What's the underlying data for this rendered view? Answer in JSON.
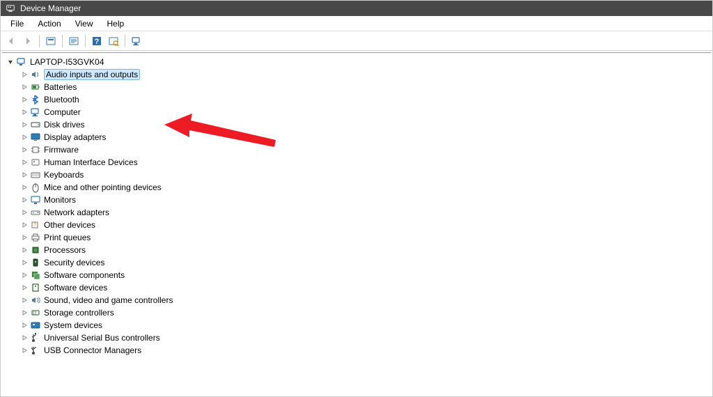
{
  "window": {
    "title": "Device Manager"
  },
  "menu": {
    "file": "File",
    "action": "Action",
    "view": "View",
    "help": "Help"
  },
  "tree": {
    "root": "LAPTOP-I53GVK04",
    "items": [
      {
        "label": "Audio inputs and outputs",
        "icon": "speaker",
        "selected": true
      },
      {
        "label": "Batteries",
        "icon": "battery"
      },
      {
        "label": "Bluetooth",
        "icon": "bluetooth"
      },
      {
        "label": "Computer",
        "icon": "computer"
      },
      {
        "label": "Disk drives",
        "icon": "disk"
      },
      {
        "label": "Display adapters",
        "icon": "display"
      },
      {
        "label": "Firmware",
        "icon": "chip"
      },
      {
        "label": "Human Interface Devices",
        "icon": "hid"
      },
      {
        "label": "Keyboards",
        "icon": "keyboard"
      },
      {
        "label": "Mice and other pointing devices",
        "icon": "mouse"
      },
      {
        "label": "Monitors",
        "icon": "monitor"
      },
      {
        "label": "Network adapters",
        "icon": "network"
      },
      {
        "label": "Other devices",
        "icon": "other"
      },
      {
        "label": "Print queues",
        "icon": "printer"
      },
      {
        "label": "Processors",
        "icon": "cpu"
      },
      {
        "label": "Security devices",
        "icon": "security"
      },
      {
        "label": "Software components",
        "icon": "software"
      },
      {
        "label": "Software devices",
        "icon": "softdev"
      },
      {
        "label": "Sound, video and game controllers",
        "icon": "sound"
      },
      {
        "label": "Storage controllers",
        "icon": "storage"
      },
      {
        "label": "System devices",
        "icon": "system"
      },
      {
        "label": "Universal Serial Bus controllers",
        "icon": "usb"
      },
      {
        "label": "USB Connector Managers",
        "icon": "usbconn"
      }
    ]
  }
}
